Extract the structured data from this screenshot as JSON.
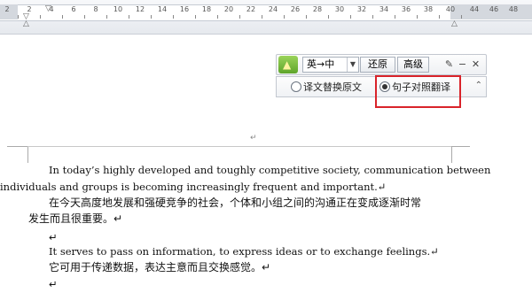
{
  "ruler": {
    "numbers": [
      "2",
      "2",
      "4",
      "6",
      "8",
      "10",
      "12",
      "14",
      "16",
      "18",
      "20",
      "22",
      "24",
      "26",
      "28",
      "30",
      "32",
      "34",
      "36",
      "38",
      "40"
    ],
    "right_numbers": [
      "44",
      "46",
      "48"
    ]
  },
  "toolbar": {
    "direction_select": "英→中",
    "restore_label": "还原",
    "advanced_label": "高级",
    "pin_icon": "pin-icon",
    "minimize_icon": "minimize-icon",
    "close_icon": "close-icon"
  },
  "options": {
    "replace_label": "译文替换原文",
    "compare_label": "句子对照翻译",
    "selected": "compare"
  },
  "document": {
    "header_mark": "↵",
    "para1_line1": "In today’s highly developed and toughly competitive society, communication between",
    "para1_line2": "individuals and groups is becoming increasingly frequent and important.↵",
    "para1_zh_line1": "在今天高度地发展和强硬竞争的社会，个体和小组之间的沟通正在变成逐渐时常",
    "para1_zh_line2": "发生而且很重要。↵",
    "empty_mark": "↵",
    "para2": "It serves to pass on information, to express ideas or to exchange feelings.↵",
    "para2_zh": "它可用于传递数据，表达主意而且交换感觉。↵",
    "trailing_mark": "↵"
  }
}
